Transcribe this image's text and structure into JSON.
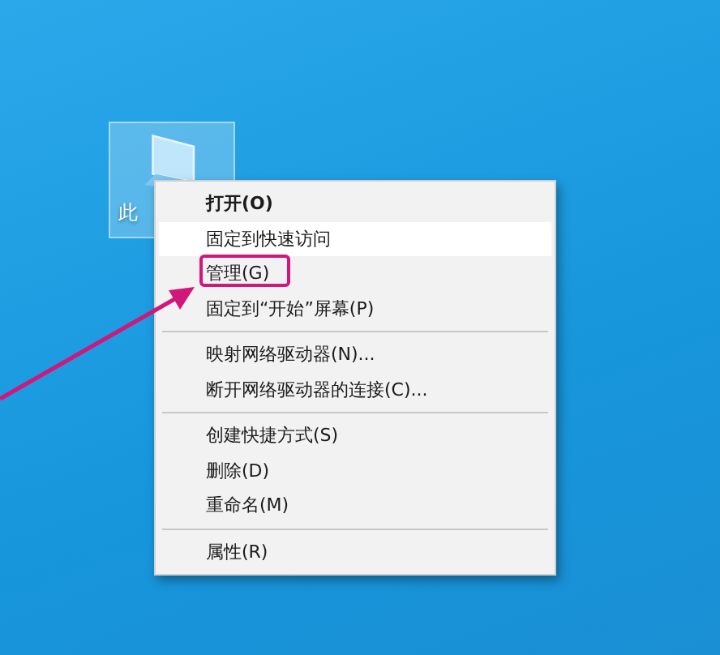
{
  "desktop_icon": {
    "label": "此",
    "selected": true
  },
  "context_menu": {
    "items": [
      {
        "kind": "item",
        "label": "打开(O)",
        "bold": true,
        "selected": false,
        "annotated": false
      },
      {
        "kind": "item",
        "label": "固定到快速访问",
        "bold": false,
        "selected": true,
        "annotated": false
      },
      {
        "kind": "item",
        "label": "管理(G)",
        "bold": false,
        "selected": false,
        "annotated": true
      },
      {
        "kind": "item",
        "label": "固定到“开始”屏幕(P)",
        "bold": false,
        "selected": false,
        "annotated": false
      },
      {
        "kind": "separator"
      },
      {
        "kind": "item",
        "label": "映射网络驱动器(N)...",
        "bold": false,
        "selected": false,
        "annotated": false
      },
      {
        "kind": "item",
        "label": "断开网络驱动器的连接(C)...",
        "bold": false,
        "selected": false,
        "annotated": false
      },
      {
        "kind": "separator"
      },
      {
        "kind": "item",
        "label": "创建快捷方式(S)",
        "bold": false,
        "selected": false,
        "annotated": false
      },
      {
        "kind": "item",
        "label": "删除(D)",
        "bold": false,
        "selected": false,
        "annotated": false
      },
      {
        "kind": "item",
        "label": "重命名(M)",
        "bold": false,
        "selected": false,
        "annotated": false
      },
      {
        "kind": "separator"
      },
      {
        "kind": "item",
        "label": "属性(R)",
        "bold": false,
        "selected": false,
        "annotated": false
      }
    ]
  },
  "annotation": {
    "kind": "arrow",
    "color": "#d0187a"
  }
}
